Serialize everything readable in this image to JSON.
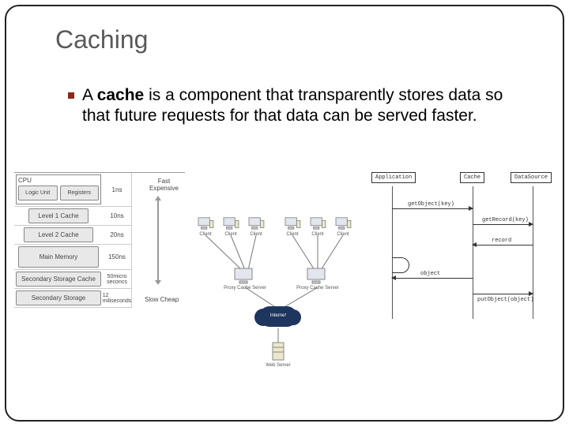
{
  "title": "Caching",
  "bullet_prefix": "A ",
  "bullet_bold": "cache",
  "bullet_rest": " is a component that transparently stores data so that future requests for that data can be served faster.",
  "memory_hierarchy": {
    "cpu_label": "CPU",
    "cpu_parts": [
      "Logic Unit",
      "Registers"
    ],
    "levels": [
      "Level 1 Cache",
      "Level 2 Cache",
      "Main Memory",
      "Secondary Storage Cache",
      "Secondary Storage"
    ],
    "times": [
      "1ns",
      "10ns",
      "20ns",
      "150ns",
      "50micro seconcs",
      "12 miliseconds"
    ],
    "top_label": "Fast Expensive",
    "bottom_label": "Slow Cheap"
  },
  "topology": {
    "client_label": "Client",
    "proxy1_label": "Proxy Cache Server",
    "proxy2_label": "Proxy Cache Server",
    "cloud_label": "Internet",
    "web_label": "Web Server"
  },
  "sequence": {
    "actors": [
      "Application",
      "Cache",
      "DataSource"
    ],
    "msgs": {
      "m1": "getObject(key)",
      "m2": "getRecord(key)",
      "m3": "record",
      "m4": "object",
      "m5": "putObject(object)"
    }
  }
}
